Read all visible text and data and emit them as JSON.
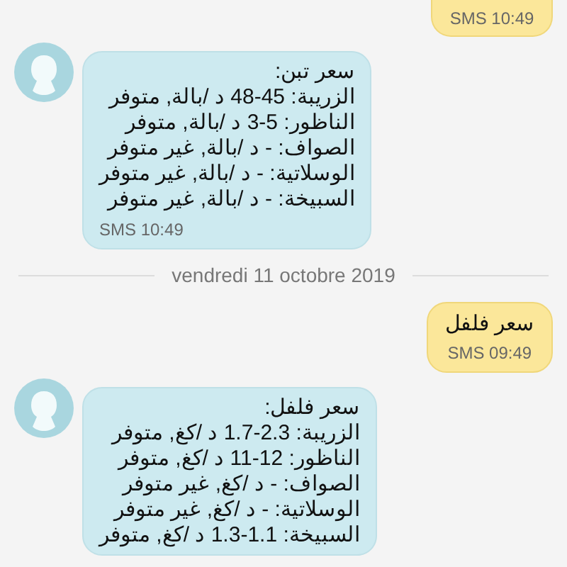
{
  "messages": [
    {
      "kind": "outgoing",
      "time": "SMS 10:49"
    },
    {
      "kind": "incoming",
      "lines": [
        "سعر تبن:",
        "الزريبة: 45-48 د /بالة, متوفر",
        "الناظور: 5-3 د /بالة, متوفر",
        "الصواف: - د /بالة, غير متوفر",
        "الوسلاتية: - د /بالة, غير متوفر",
        "السبيخة: - د /بالة, غير متوفر"
      ],
      "time": "SMS 10:49"
    },
    {
      "kind": "date",
      "text": "vendredi 11 octobre 2019"
    },
    {
      "kind": "outgoing",
      "lines": [
        "سعر فلفل"
      ],
      "time": "SMS 09:49"
    },
    {
      "kind": "incoming",
      "lines": [
        "سعر فلفل:",
        "الزريبة: 2.3-1.7 د /كغ, متوفر",
        "الناظور: 12-11 د /كغ, متوفر",
        "الصواف: - د /كغ, غير متوفر",
        "الوسلاتية: - د /كغ, غير متوفر",
        "السبيخة: 1.1-1.3 د /كغ, متوفر"
      ]
    }
  ]
}
